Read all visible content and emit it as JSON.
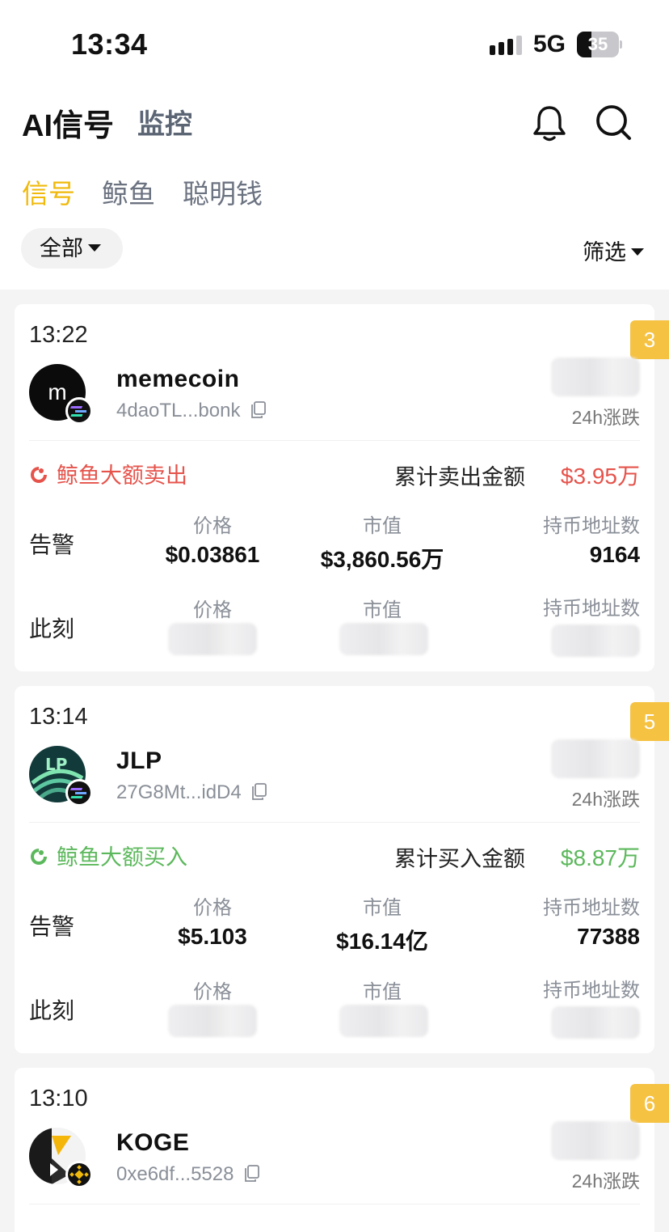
{
  "status_bar": {
    "time": "13:34",
    "network": "5G",
    "battery": "35",
    "battery_level": 0.35
  },
  "header": {
    "title": "AI信号",
    "monitor_tab": "监控"
  },
  "tabs": [
    {
      "label": "信号",
      "active": true
    },
    {
      "label": "鲸鱼"
    },
    {
      "label": "聪明钱"
    }
  ],
  "filters": {
    "scope": "全部",
    "filter": "筛选"
  },
  "labels": {
    "change_24h": "24h涨跌",
    "alert": "告警",
    "now": "此刻",
    "price": "价格",
    "mcap": "市值",
    "holders": "持币地址数"
  },
  "colors": {
    "accent": "#f0b90b",
    "sell": "#e5534b",
    "buy": "#5cb85c",
    "badge": "#f5c242"
  },
  "cards": [
    {
      "time": "13:22",
      "badge": "3",
      "name": "memecoin",
      "avatar_letter": "m",
      "address": "4daoTL...bonk",
      "chain": "solana",
      "event": "鲸鱼大额卖出",
      "event_type": "sell",
      "sum_label": "累计卖出金额",
      "sum_value": "$3.95万",
      "alert_price": "$0.03861",
      "alert_mcap": "$3,860.56万",
      "alert_holders": "9164"
    },
    {
      "time": "13:14",
      "badge": "5",
      "name": "JLP",
      "avatar_letter": "LP",
      "address": "27G8Mt...idD4",
      "chain": "solana",
      "event": "鲸鱼大额买入",
      "event_type": "buy",
      "sum_label": "累计买入金额",
      "sum_value": "$8.87万",
      "alert_price": "$5.103",
      "alert_mcap": "$16.14亿",
      "alert_holders": "77388"
    },
    {
      "time": "13:10",
      "badge": "6",
      "name": "KOGE",
      "address": "0xe6df...5528",
      "chain": "bnb"
    }
  ]
}
